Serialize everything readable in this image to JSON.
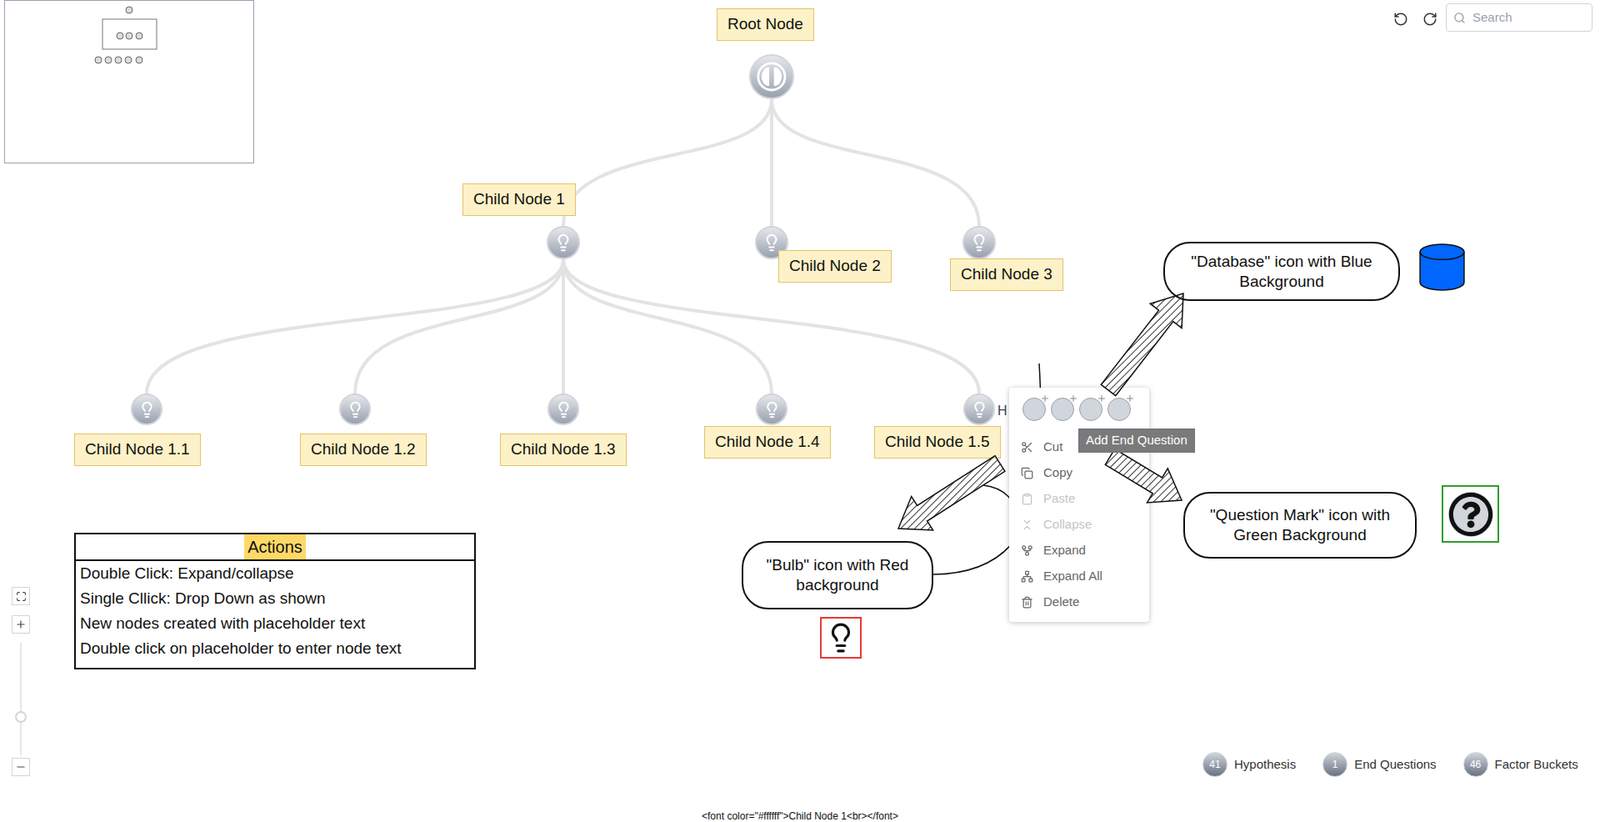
{
  "toolbar": {
    "search_placeholder": "Search"
  },
  "nodes": [
    {
      "label": "Root Node",
      "kind": "root"
    },
    {
      "label": "Child Node 1",
      "kind": "hypothesis"
    },
    {
      "label": "Child Node 2",
      "kind": "hypothesis"
    },
    {
      "label": "Child Node 3",
      "kind": "hypothesis"
    },
    {
      "label": "Child Node 1.1",
      "kind": "hypothesis"
    },
    {
      "label": "Child Node 1.2",
      "kind": "hypothesis"
    },
    {
      "label": "Child Node 1.3",
      "kind": "hypothesis"
    },
    {
      "label": "Child Node 1.4",
      "kind": "hypothesis"
    },
    {
      "label": "Child Node 1.5",
      "kind": "hypothesis"
    }
  ],
  "partial_label": "H",
  "context_menu": {
    "items": [
      {
        "label": "Cut",
        "disabled": false
      },
      {
        "label": "Copy",
        "disabled": false
      },
      {
        "label": "Paste",
        "disabled": true
      },
      {
        "label": "Collapse",
        "disabled": true
      },
      {
        "label": "Expand",
        "disabled": false
      },
      {
        "label": "Expand All",
        "disabled": false
      },
      {
        "label": "Delete",
        "disabled": false
      }
    ],
    "tooltip": "Add End Question"
  },
  "callouts": [
    {
      "text": "\"Database\" icon with Blue Background",
      "kind": "database",
      "color": "#0066ff"
    },
    {
      "text": "\"Bulb\" icon with Red background",
      "kind": "bulb",
      "color": "#e53935"
    },
    {
      "text": "\"Question Mark\" icon with Green Background",
      "kind": "question",
      "color": "#2e9e2e"
    }
  ],
  "actions_table": {
    "title": "Actions",
    "rows": [
      "Double Click: Expand/collapse",
      "Single Cllick: Drop Down as shown",
      "New nodes created with placeholder text",
      "Double click on placeholder to enter node text"
    ]
  },
  "zoom": {
    "level": 0.34
  },
  "legend": [
    {
      "count": "41",
      "label": "Hypothesis"
    },
    {
      "count": "1",
      "label": "End Questions"
    },
    {
      "count": "46",
      "label": "Factor Buckets"
    }
  ],
  "status_text": "<font color=\"#ffffff\">Child Node 1<br></font>"
}
